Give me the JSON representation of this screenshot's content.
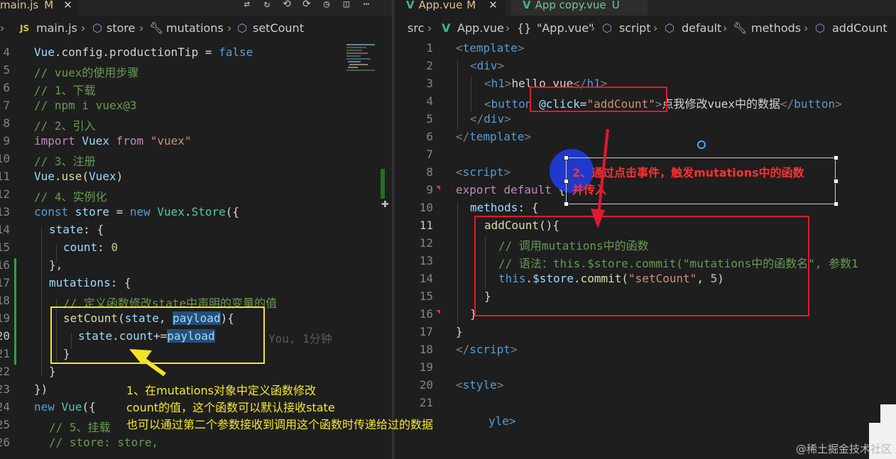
{
  "left": {
    "tab": {
      "name": "main.js",
      "status": "M",
      "close": "✕"
    },
    "breadcrumb": {
      "file": "main.js",
      "c1": "store",
      "c2": "mutations",
      "c3": "setCount"
    },
    "lines": [
      {
        "n": "4"
      },
      {
        "n": "5"
      },
      {
        "n": "6"
      },
      {
        "n": "7"
      },
      {
        "n": "8"
      },
      {
        "n": "9"
      },
      {
        "n": "10"
      },
      {
        "n": "11"
      },
      {
        "n": "12"
      },
      {
        "n": "13"
      },
      {
        "n": "14"
      },
      {
        "n": "15"
      },
      {
        "n": "16"
      },
      {
        "n": "17"
      },
      {
        "n": "18"
      },
      {
        "n": "19"
      },
      {
        "n": "20"
      },
      {
        "n": "21"
      },
      {
        "n": "22"
      },
      {
        "n": "23"
      },
      {
        "n": "24"
      },
      {
        "n": "25"
      },
      {
        "n": "26"
      }
    ],
    "code": {
      "l4": [
        "Vue",
        ".config.productionTip = ",
        "false"
      ],
      "l5": "// vuex的使用步骤",
      "l6": "// 1、下载",
      "l7": "// npm i vuex@3",
      "l8": "// 2、引入",
      "l9": [
        "import",
        " Vuex ",
        "from",
        " \"vuex\""
      ],
      "l10": "// 3、注册",
      "l11": [
        "Vue",
        ".use(",
        "Vuex",
        ")"
      ],
      "l12": "// 4、实例化",
      "l13": [
        "const",
        " store",
        " = ",
        "new",
        " Vuex",
        ".",
        "Store",
        "({"
      ],
      "l14": [
        "state",
        ": {"
      ],
      "l15": [
        "count",
        ": ",
        "0"
      ],
      "l16": "},",
      "l17": [
        "mutations",
        ": {"
      ],
      "l18": "// 定义函数修改state中声明的变量的值",
      "l19": [
        "setCount",
        "(",
        "state",
        ", ",
        "payload",
        "){"
      ],
      "l20": [
        "state",
        ".",
        "count",
        "+=",
        "payload"
      ],
      "l20_blame": "You, 1分钟",
      "l21": "}",
      "l22": "}",
      "l23": "})",
      "l24": [
        "new",
        " Vue",
        "({"
      ],
      "l25": "// 5、挂载",
      "l26": "// store: store,"
    }
  },
  "right": {
    "tabs": [
      {
        "name": "App.vue",
        "status": "M",
        "close": "✕"
      },
      {
        "name": "App copy.vue",
        "status": "U"
      }
    ],
    "breadcrumb": {
      "src": "src",
      "file": "App.vue",
      "obj": "\"App.vue\"",
      "script": "script",
      "default": "default",
      "methods": "methods",
      "fn": "addCount"
    },
    "lines": [
      {
        "n": "1"
      },
      {
        "n": "2"
      },
      {
        "n": "3"
      },
      {
        "n": "4"
      },
      {
        "n": "5"
      },
      {
        "n": "6"
      },
      {
        "n": "7"
      },
      {
        "n": "8"
      },
      {
        "n": "9"
      },
      {
        "n": "10"
      },
      {
        "n": "11"
      },
      {
        "n": "12"
      },
      {
        "n": "13"
      },
      {
        "n": "14"
      },
      {
        "n": "15"
      },
      {
        "n": "16"
      },
      {
        "n": "17"
      },
      {
        "n": "18"
      },
      {
        "n": "19"
      },
      {
        "n": "20"
      },
      {
        "n": "21"
      }
    ],
    "code": {
      "l1": [
        "<",
        "template",
        ">"
      ],
      "l2": [
        "<",
        "div",
        ">"
      ],
      "l3": [
        "<",
        "h1",
        ">",
        "hello vue",
        "</",
        "h1",
        ">"
      ],
      "l4": [
        "<",
        "button",
        " ",
        "@click",
        "=",
        "\"addCount\"",
        ">",
        "点我修改vuex中的数据",
        "</",
        "button",
        ">"
      ],
      "l5": [
        "</",
        "div",
        ">"
      ],
      "l6": [
        "</",
        "template",
        ">"
      ],
      "l8": [
        "<",
        "script",
        ">"
      ],
      "l9": [
        "export",
        " ",
        "default",
        " {"
      ],
      "l10": [
        "methods",
        ": {"
      ],
      "l11": [
        "addCount",
        "(){"
      ],
      "l12": "// 调用mutations中的函数",
      "l13": "// 语法：this.$store.commit(\"mutations中的函数名\", 参数1",
      "l14": [
        "this",
        ".",
        "$store",
        ".",
        "commit",
        "(",
        "\"setCount\"",
        ", ",
        "5",
        ")"
      ],
      "l15": "}",
      "l16": "}",
      "l17": "}",
      "l18": [
        "</",
        "script",
        ">"
      ],
      "l20": [
        "<",
        "style",
        ">"
      ],
      "l22_tail": "yle>"
    }
  },
  "annotations": {
    "yellow": [
      "1、在mutations对象中定义函数修改",
      "count的值，这个函数可以默认接收state",
      "也可以通过第二个参数接收到调用这个函数时传递给过的数据"
    ],
    "red": [
      "2、通过点击事件，触发mutations中的函数",
      "并传入"
    ]
  },
  "watermark": "@稀土掘金技术社区",
  "colors": {
    "annotation_red": "#e0192f",
    "annotation_yellow": "#f3e428",
    "vue_green": "#41b883"
  },
  "icons": [
    "js-file-icon",
    "cube-icon",
    "wrench-icon",
    "vue-logo-icon",
    "braces-icon",
    "split-editor-icon"
  ]
}
